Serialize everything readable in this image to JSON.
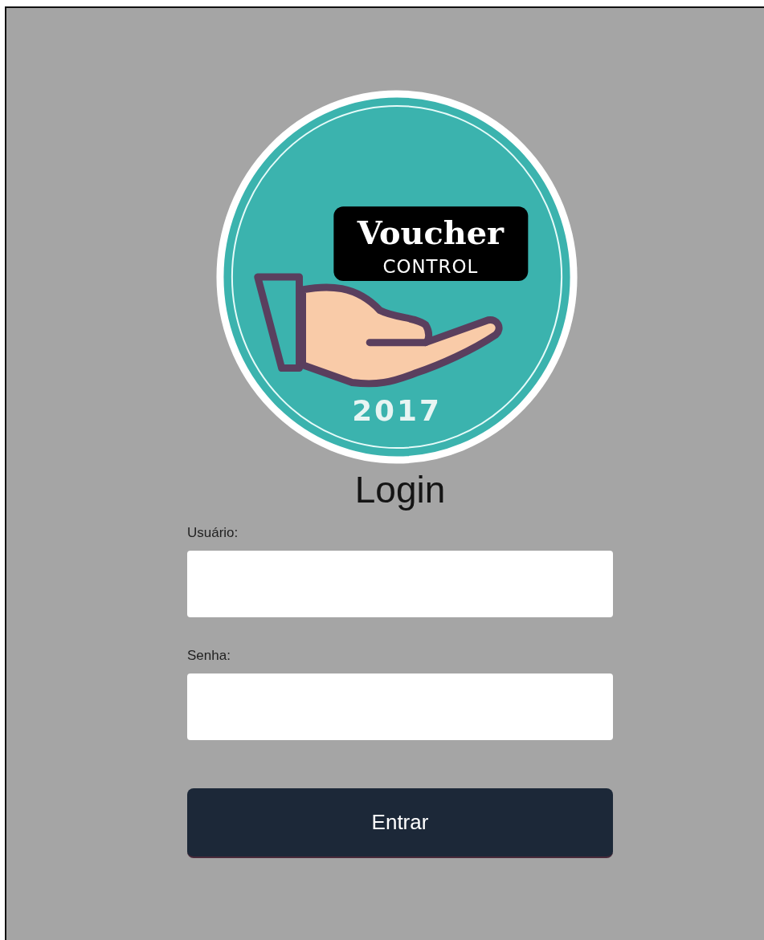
{
  "logo": {
    "title": "Voucher",
    "subtitle": "CONTROL",
    "year": "2017"
  },
  "heading": "Login",
  "fields": [
    {
      "label": "Usuário:"
    },
    {
      "label": "Senha:"
    }
  ],
  "submit_button": "Entrar"
}
